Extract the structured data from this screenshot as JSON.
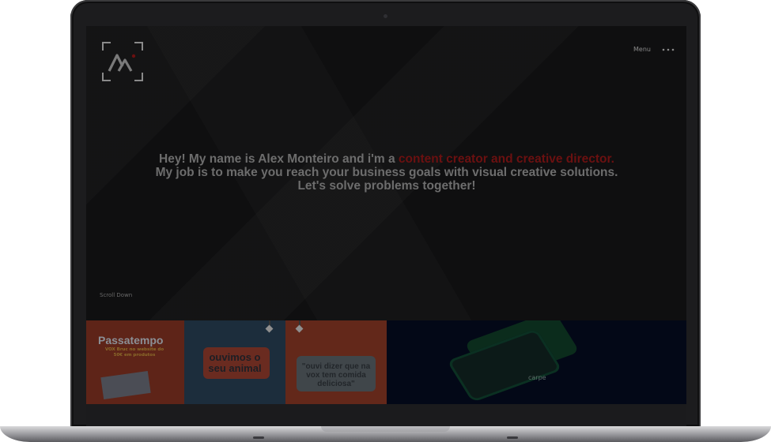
{
  "header": {
    "logo_icon": "am-monogram-logo-icon",
    "menu_label": "Menu",
    "menu_icon": "more-dots-icon"
  },
  "hero": {
    "intro_prefix": "Hey! My name is Alex Monteiro and i'm a ",
    "intro_highlight": "content creator and creative director.",
    "intro_line2": "My job is to make you reach your business goals with visual creative solutions.",
    "intro_line3": "Let's solve problems together!",
    "scroll_down": "Scroll Down"
  },
  "portfolio": {
    "tile1": {
      "title": "Passatempo",
      "subtitle_line1": "VOX Bruc no website do",
      "subtitle_line2": "50€ em produtos"
    },
    "tile2": {
      "line1": "ouvimos o",
      "line2": "seu animal"
    },
    "tile3": {
      "line1": "\"ouvi dizer que na",
      "line2": "vox tem comida",
      "line3": "deliciosa\""
    },
    "tile4": {
      "brand": "carpe"
    }
  },
  "colors": {
    "accent": "#6b1010",
    "text_muted": "#6d6d6d",
    "screen_bg": "#0f0f10"
  }
}
